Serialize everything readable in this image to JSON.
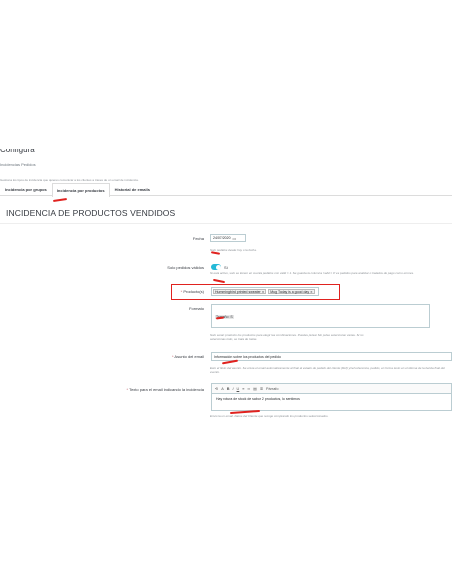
{
  "header": {
    "subtitle": "Incidencias Pedidos",
    "description": "Gestiona los tipos de incidencia que quieres comunicar a los clientes a traves de un email de incidencia."
  },
  "tabs": [
    {
      "label": "Incidencia por grupos"
    },
    {
      "label": "Incidencia por productos"
    },
    {
      "label": "Historial de emails"
    }
  ],
  "section": {
    "title": "INCIDENCIA DE PRODUCTOS VENDIDOS"
  },
  "form": {
    "fecha": {
      "label": "Fecha",
      "value": "24/07/2020",
      "help": "Solo pedidos desde hoy o la fecha."
    },
    "solo_validos": {
      "label": "Solo pedidos válidos",
      "value": "Sí",
      "help": "Si esta activo, solo se tienen en cuenta pedidos con valid = 1. Se guarda la columna 'valid = 0' es pedidos para analizar o tratados de pago como errores."
    },
    "productos": {
      "label": "Producto(s)",
      "tags": [
        "Hummingbird printed sweater",
        "Mug Today is a good day"
      ]
    },
    "formato": {
      "label": "Formato",
      "tag": "Tamaño: S",
      "help": "Solo serán producto los productos para elegir las combinaciones. Puedes pulsar Sin pulse seleccionar varias. Si no seleccionas todo, se trata de todas."
    },
    "asunto": {
      "label": "Asunto del email",
      "value": "Información sobre los productos del pedido",
      "help": "Esto el titulo del asunto. Se envia el email automaticamente al final al estado de pedido del cliente (Ref) y/ref-referencia, pedido, en forma texto en el idioma de la tienda final del evento."
    },
    "texto": {
      "label": "Texto para el email indicando la incidencia",
      "toolbar": [
        "⟲",
        "A",
        "B",
        "I",
        "U",
        "≡",
        "∞",
        "▤",
        "≣",
        "Párrafo"
      ],
      "body": "Hay rotura de stock de sabor 2 productos, lo sentimos",
      "help": "Envio la un email. Datos del Cliente que recoge comprando los productos seleccionados."
    }
  },
  "colors": {
    "accent": "#25b9d7",
    "marker": "#e0221f",
    "text": "#363a41"
  }
}
